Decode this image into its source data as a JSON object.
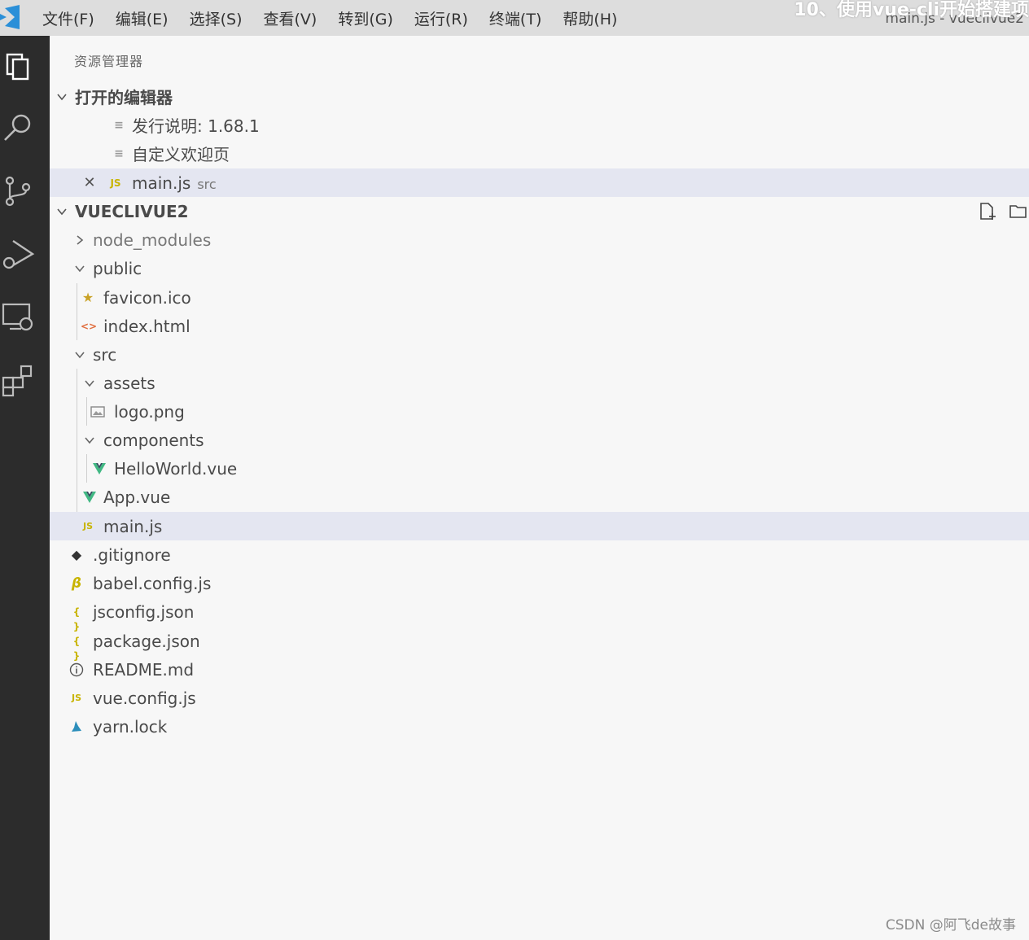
{
  "menu": [
    "文件(F)",
    "编辑(E)",
    "选择(S)",
    "查看(V)",
    "转到(G)",
    "运行(R)",
    "终端(T)",
    "帮助(H)"
  ],
  "window_title": "main.js - vueclivue2",
  "overlay_caption": "10、使用vue-cli开始搭建项",
  "explorer": {
    "title": "资源管理器",
    "open_editors": {
      "header": "打开的编辑器",
      "items": [
        {
          "label": "发行说明: 1.68.1",
          "sub": ""
        },
        {
          "label": "自定义欢迎页",
          "sub": ""
        },
        {
          "label": "main.js",
          "sub": "src"
        }
      ]
    },
    "project": {
      "header": "VUECLIVUE2",
      "items": [
        {
          "label": "node_modules",
          "icon": "chevron-right-icon"
        },
        {
          "label": "public",
          "icon": "chevron-down-icon"
        },
        {
          "label": "favicon.ico",
          "icon": "star-icon"
        },
        {
          "label": "index.html",
          "icon": "html-icon"
        },
        {
          "label": "src",
          "icon": "chevron-down-icon"
        },
        {
          "label": "assets",
          "icon": "chevron-down-icon"
        },
        {
          "label": "logo.png",
          "icon": "image-icon"
        },
        {
          "label": "components",
          "icon": "chevron-down-icon"
        },
        {
          "label": "HelloWorld.vue",
          "icon": "vue-icon"
        },
        {
          "label": "App.vue",
          "icon": "vue-icon"
        },
        {
          "label": "main.js",
          "icon": "js-icon"
        },
        {
          "label": ".gitignore",
          "icon": "git-icon"
        },
        {
          "label": "babel.config.js",
          "icon": "babel-icon"
        },
        {
          "label": "jsconfig.json",
          "icon": "json-icon"
        },
        {
          "label": "package.json",
          "icon": "json-icon"
        },
        {
          "label": "README.md",
          "icon": "info-icon"
        },
        {
          "label": "vue.config.js",
          "icon": "js-icon"
        },
        {
          "label": "yarn.lock",
          "icon": "yarn-icon"
        }
      ]
    }
  },
  "icon_text": {
    "js": "JS",
    "json": "{ }",
    "html": "<>"
  },
  "watermark": "CSDN @阿飞de故事",
  "colors": {
    "activity_bar": "#2c2c2c",
    "sidebar": "#f7f7f7",
    "selection": "#e4e6f1",
    "vue_green": "#41b883",
    "js_yellow": "#c8b400",
    "vscode_blue": "#2a8fd8"
  }
}
